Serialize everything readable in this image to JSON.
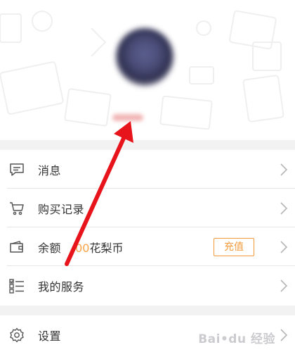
{
  "profile": {
    "avatar_icon": "avatar-blurred"
  },
  "menu": {
    "messages_label": "消息",
    "purchase_history_label": "购买记录",
    "balance_label": "余额",
    "balance_amount": ".00",
    "balance_unit": "花梨币",
    "recharge_label": "充值",
    "my_services_label": "我的服务",
    "settings_label": "设置"
  },
  "icons": {
    "messages": "chat-bubble-icon",
    "purchase_history": "cart-icon",
    "balance": "wallet-icon",
    "my_services": "checklist-icon",
    "settings": "gear-icon",
    "chevron": "chevron-right-icon"
  },
  "colors": {
    "accent": "#f39b3c",
    "amount": "#f7a24a",
    "annotation_arrow": "#e8141b"
  },
  "watermark": {
    "text": "Bai•du 经验",
    "logo": "baidu-paw-logo"
  }
}
